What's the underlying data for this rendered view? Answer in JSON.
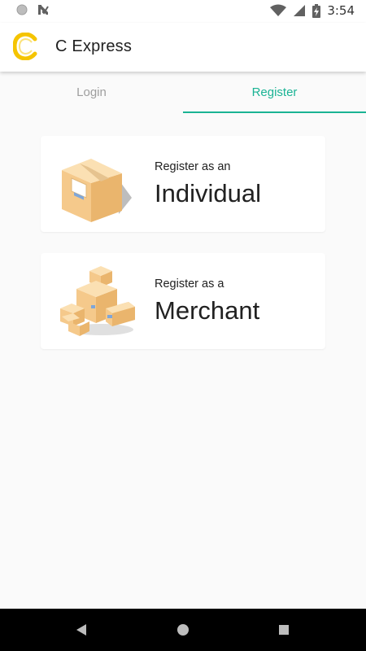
{
  "status_bar": {
    "time": "3:54",
    "icons": [
      "record-icon",
      "notification-check-icon",
      "wifi-icon",
      "signal-icon",
      "battery-charging-icon"
    ]
  },
  "app_bar": {
    "title": "C Express",
    "logo_letter": "C"
  },
  "tabs": [
    {
      "label": "Login",
      "active": false
    },
    {
      "label": "Register",
      "active": true
    }
  ],
  "options": [
    {
      "prefix": "Register as an",
      "label": "Individual",
      "icon": "single-box-icon"
    },
    {
      "prefix": "Register as a",
      "label": "Merchant",
      "icon": "box-stack-icon"
    }
  ],
  "nav_bar": {
    "icons": [
      "back-icon",
      "home-icon",
      "recents-icon"
    ]
  },
  "colors": {
    "accent": "#1ab394",
    "inactive_tab": "#9e9e9e",
    "logo": "#f5c400",
    "box": "#f5c98b",
    "background": "#fafafa"
  }
}
